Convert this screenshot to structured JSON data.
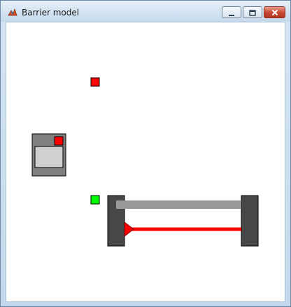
{
  "window": {
    "title": "Barrier model"
  },
  "icons": {
    "app": "matlab-icon",
    "minimize": "minimize-icon",
    "maximize": "maximize-icon",
    "close": "close-icon"
  },
  "colors": {
    "client_bg": "#ffffff",
    "indicator_red": "#ff0000",
    "indicator_green": "#00ff00",
    "device_body": "#7f7f7f",
    "device_screen": "#d0d0d0",
    "pillar": "#474747",
    "barrier_bar": "#999999",
    "beam": "#ff0000"
  }
}
